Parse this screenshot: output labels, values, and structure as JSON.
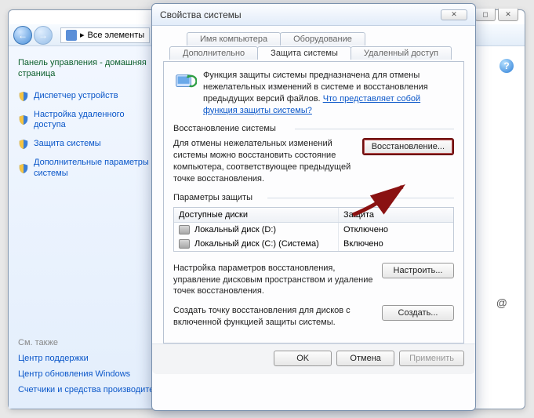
{
  "parent": {
    "breadcrumb": "Все элементы",
    "sidebar_title": "Панель управления - домашняя страница",
    "links": [
      "Диспетчер устройств",
      "Настройка удаленного доступа",
      "Защита системы",
      "Дополнительные параметры системы"
    ],
    "see_also_header": "См. также",
    "see_also": [
      "Центр поддержки",
      "Центр обновления Windows",
      "Счетчики и средства производительности"
    ]
  },
  "dialog": {
    "title": "Свойства системы",
    "tabs_row1": [
      "Имя компьютера",
      "Оборудование"
    ],
    "tabs_row2": [
      "Дополнительно",
      "Защита системы",
      "Удаленный доступ"
    ],
    "active_tab": "Защита системы",
    "info_text": "Функция защиты системы предназначена для отмены нежелательных изменений в системе и восстановления предыдущих версий файлов. ",
    "info_link": "Что представляет собой функция защиты системы?",
    "restore_group": "Восстановление системы",
    "restore_text": "Для отмены нежелательных изменений системы можно восстановить состояние компьютера, соответствующее предыдущей точке восстановления.",
    "restore_btn": "Восстановление...",
    "params_group": "Параметры защиты",
    "table": {
      "col1": "Доступные диски",
      "col2": "Защита",
      "rows": [
        {
          "name": "Локальный диск (D:)",
          "status": "Отключено"
        },
        {
          "name": "Локальный диск (C:) (Система)",
          "status": "Включено"
        }
      ]
    },
    "config_text": "Настройка параметров восстановления, управление дисковым пространством и удаление точек восстановления.",
    "config_btn": "Настроить...",
    "create_text": "Создать точку восстановления для дисков с включенной функцией защиты системы.",
    "create_btn": "Создать...",
    "buttons": {
      "ok": "OK",
      "cancel": "Отмена",
      "apply": "Применить"
    }
  }
}
